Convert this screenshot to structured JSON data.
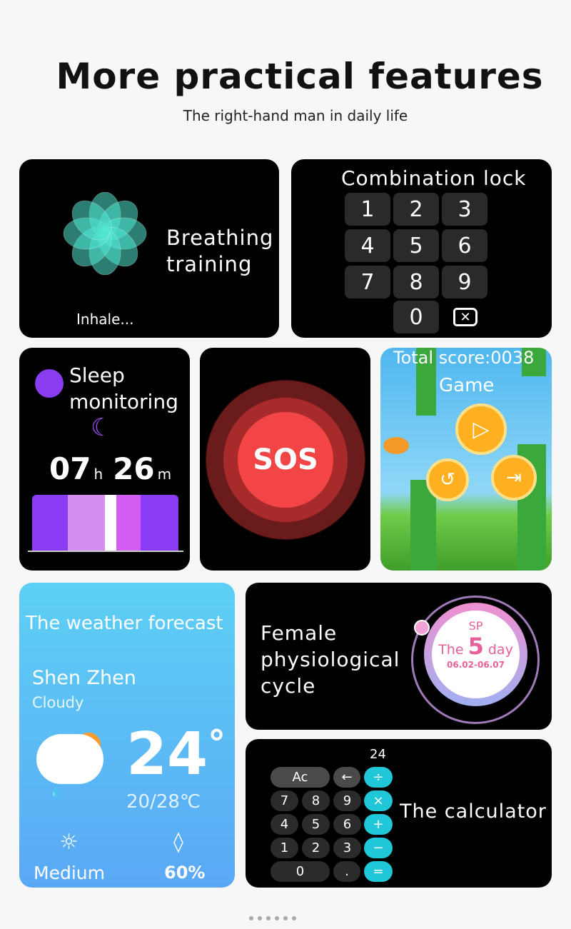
{
  "header": {
    "title": "More practical features",
    "subtitle": "The right-hand man in daily life"
  },
  "breathing": {
    "title_line1": "Breathing",
    "title_line2": "training",
    "status": "Inhale..."
  },
  "lock": {
    "title": "Combination lock",
    "keys": [
      "1",
      "2",
      "3",
      "4",
      "5",
      "6",
      "7",
      "8",
      "9"
    ],
    "zero": "0",
    "delete_icon": "backspace-icon"
  },
  "sleep": {
    "title_line1": "Sleep",
    "title_line2": "monitoring",
    "hours": "07",
    "h_unit": "h",
    "minutes": "26",
    "m_unit": "m",
    "bar_colors": [
      "#8b3cf2",
      "#d38cf0",
      "#ffffff",
      "#d35cf3",
      "#8b3cf2"
    ]
  },
  "sos": {
    "label": "SOS"
  },
  "game": {
    "score": "Total score:0038",
    "title": "Game"
  },
  "weather": {
    "title": "The weather forecast",
    "city": "Shen Zhen",
    "condition": "Cloudy",
    "temp": "24",
    "degree": "°",
    "range": "20/28℃",
    "uv": "Medium",
    "humidity": "60%"
  },
  "female": {
    "line1": "Female",
    "line2": "physiological",
    "line3": "cycle",
    "sp": "SP",
    "the": "The",
    "day_num": "5",
    "day": "day",
    "dates": "06.02-06.07"
  },
  "calc": {
    "display": "24",
    "ac": "Ac",
    "back": "←",
    "div": "÷",
    "mul": "×",
    "add": "+",
    "sub": "−",
    "eq": "=",
    "rows": [
      [
        "7",
        "8",
        "9"
      ],
      [
        "4",
        "5",
        "6"
      ],
      [
        "1",
        "2",
        "3"
      ]
    ],
    "zero": "0",
    "dot": ".",
    "title": "The calculator"
  },
  "colors": {
    "accent_cyan": "#1fc7d8",
    "sos_red": "#f04040",
    "female_pink": "#e8609a"
  }
}
